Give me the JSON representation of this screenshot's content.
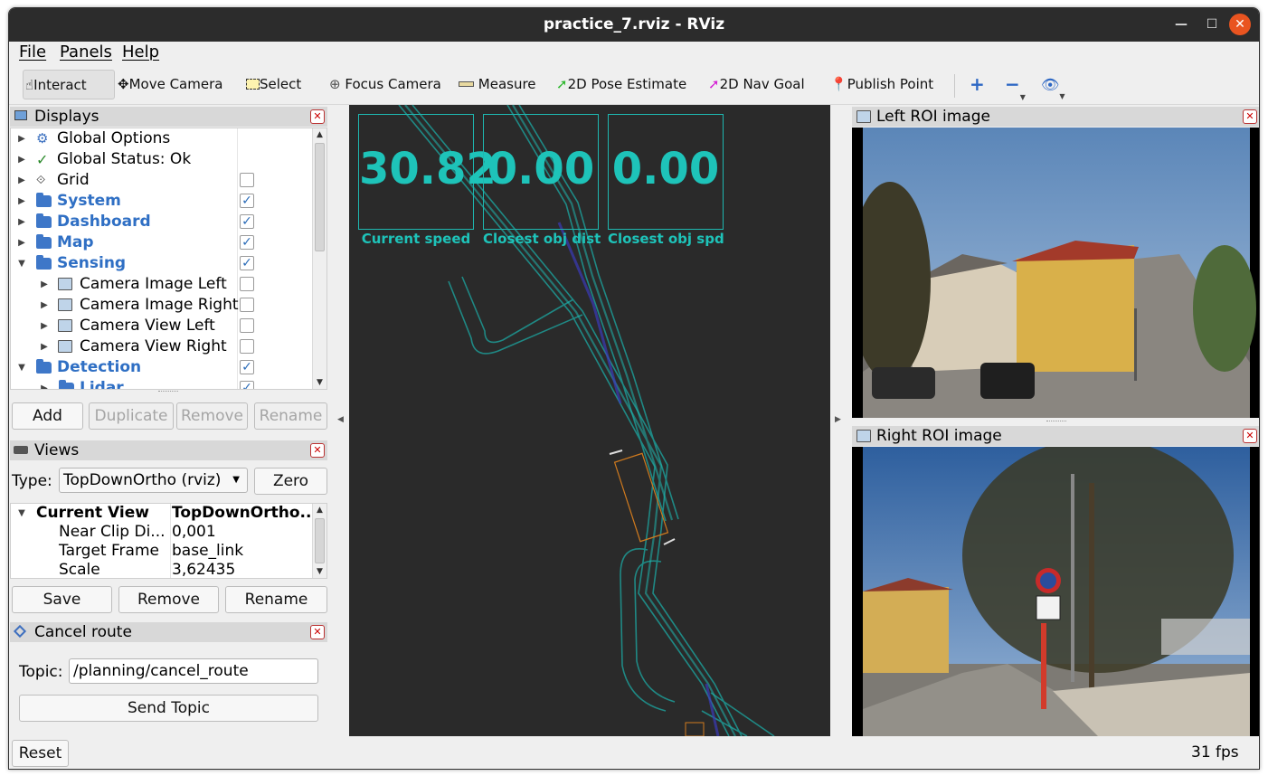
{
  "window": {
    "title": "practice_7.rviz - RViz"
  },
  "menu": {
    "file": "File",
    "panels": "Panels",
    "help": "Help"
  },
  "toolbar": {
    "interact": "Interact",
    "move_camera": "Move Camera",
    "select": "Select",
    "focus_camera": "Focus Camera",
    "measure": "Measure",
    "pose_estimate": "2D Pose Estimate",
    "nav_goal": "2D Nav Goal",
    "publish_point": "Publish Point"
  },
  "displays": {
    "title": "Displays",
    "items": [
      {
        "label": "Global Options",
        "level": 0,
        "expanded": false,
        "checkbox": null
      },
      {
        "label": "Global Status: Ok",
        "level": 0,
        "expanded": false,
        "checkbox": null
      },
      {
        "label": "Grid",
        "level": 0,
        "expanded": false,
        "checkbox": false
      },
      {
        "label": "System",
        "level": 0,
        "expanded": false,
        "checkbox": true
      },
      {
        "label": "Dashboard",
        "level": 0,
        "expanded": false,
        "checkbox": true
      },
      {
        "label": "Map",
        "level": 0,
        "expanded": false,
        "checkbox": true
      },
      {
        "label": "Sensing",
        "level": 0,
        "expanded": true,
        "checkbox": true
      },
      {
        "label": "Camera Image Left",
        "level": 1,
        "expanded": false,
        "checkbox": false
      },
      {
        "label": "Camera Image Right",
        "level": 1,
        "expanded": false,
        "checkbox": false
      },
      {
        "label": "Camera View Left",
        "level": 1,
        "expanded": false,
        "checkbox": false
      },
      {
        "label": "Camera View Right",
        "level": 1,
        "expanded": false,
        "checkbox": false
      },
      {
        "label": "Detection",
        "level": 0,
        "expanded": true,
        "checkbox": true
      },
      {
        "label": "Lidar",
        "level": 1,
        "expanded": false,
        "checkbox": true
      }
    ],
    "buttons": {
      "add": "Add",
      "duplicate": "Duplicate",
      "remove": "Remove",
      "rename": "Rename"
    }
  },
  "views": {
    "title": "Views",
    "type_label": "Type:",
    "type_value": "TopDownOrtho (rviz)",
    "zero": "Zero",
    "rows": [
      {
        "key": "Current View",
        "value": "TopDownOrtho..."
      },
      {
        "key": "Near Clip Di...",
        "value": "0,001"
      },
      {
        "key": "Target Frame",
        "value": "base_link"
      },
      {
        "key": "Scale",
        "value": "3,62435"
      }
    ],
    "buttons": {
      "save": "Save",
      "remove": "Remove",
      "rename": "Rename"
    }
  },
  "cancel_route": {
    "title": "Cancel route",
    "topic_label": "Topic:",
    "topic_value": "/planning/cancel_route",
    "send": "Send Topic"
  },
  "overlay": {
    "speed": {
      "value": "30.82",
      "label": "Current speed"
    },
    "obj_dist": {
      "value": "0.00",
      "label": "Closest obj dist"
    },
    "obj_spd": {
      "value": "0.00",
      "label": "Closest obj spd"
    }
  },
  "left_roi": {
    "title": "Left ROI image"
  },
  "right_roi": {
    "title": "Right ROI image"
  },
  "status": {
    "reset": "Reset",
    "fps": "31 fps"
  },
  "colors": {
    "overlay_text": "#1ec3b9",
    "folder_label": "#2f6fc4",
    "canvas_bg": "#2a2a2a"
  }
}
